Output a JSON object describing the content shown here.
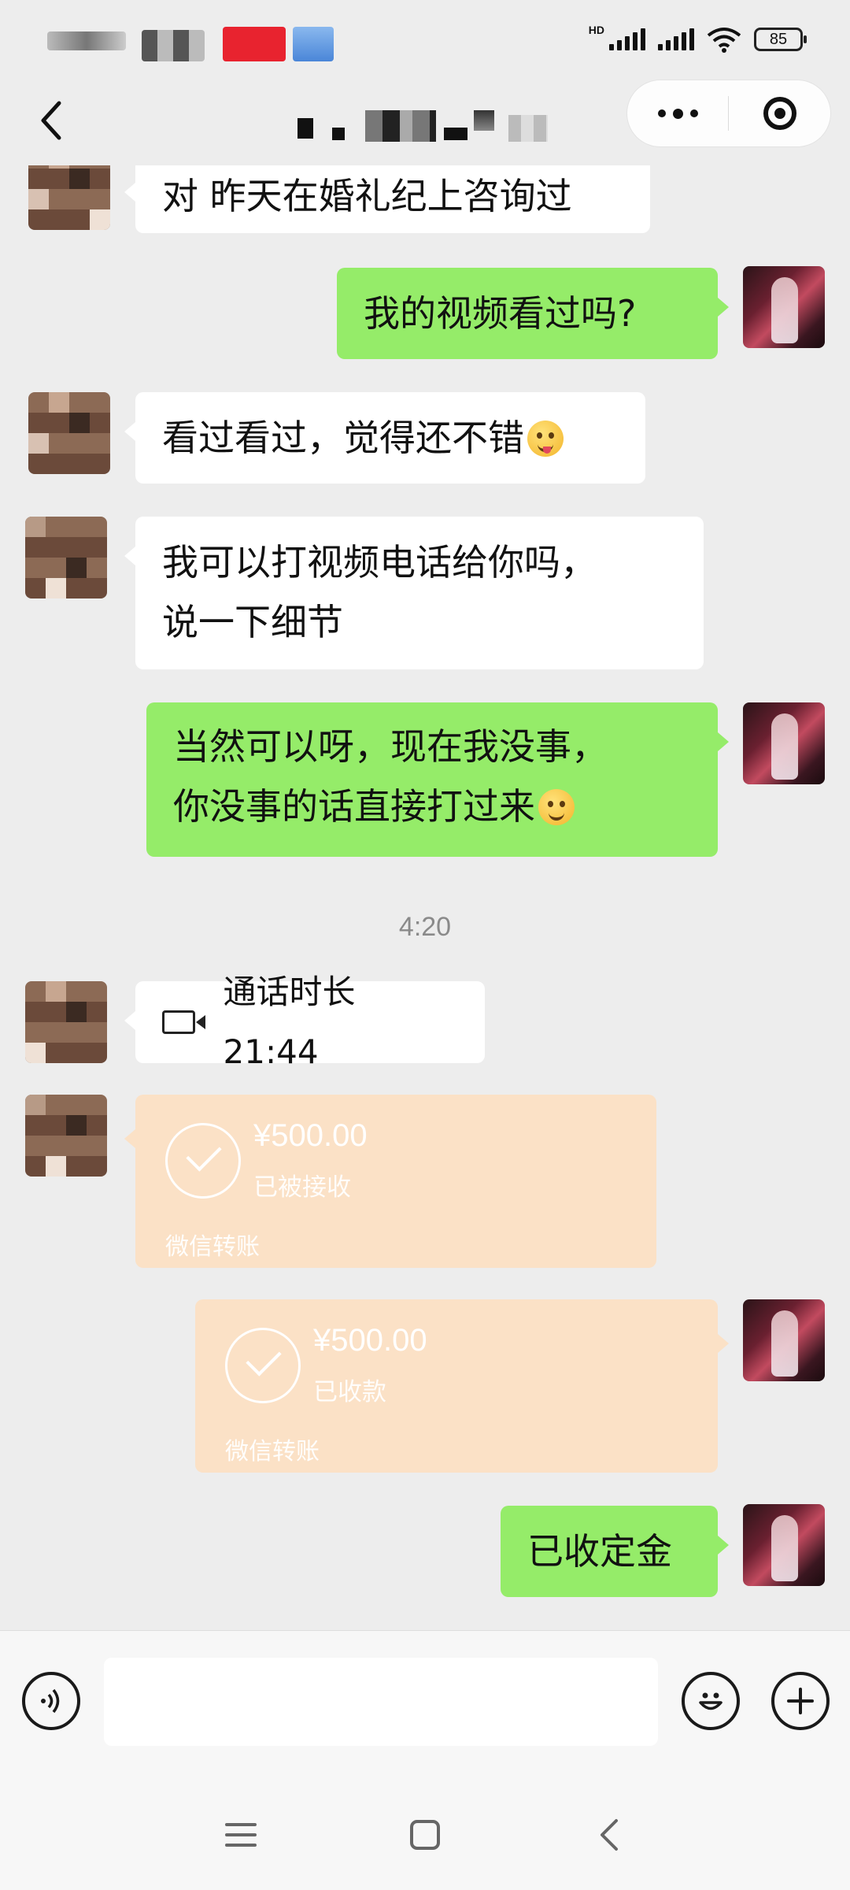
{
  "status_bar": {
    "network_tag": "HD",
    "battery": "85"
  },
  "header": {
    "capsule_more_icon": "more-dots-icon",
    "capsule_close_icon": "target-icon"
  },
  "messages": [
    {
      "side": "left",
      "text": "对 昨天在婚礼纪上咨询过"
    },
    {
      "side": "right",
      "text": "我的视频看过吗?"
    },
    {
      "side": "left",
      "text": "看过看过，觉得还不错"
    },
    {
      "side": "left",
      "line1": "我可以打视频电话给你吗，",
      "line2": "说一下细节"
    },
    {
      "side": "right",
      "line1": "当然可以呀，现在我没事，",
      "line2": "你没事的话直接打过来"
    }
  ],
  "timestamp": "4:20",
  "call": {
    "label": "通话时长 21:44",
    "icon": "video-call-icon"
  },
  "transfers": [
    {
      "side": "left",
      "amount": "¥500.00",
      "status": "已被接收",
      "brand": "微信转账"
    },
    {
      "side": "right",
      "amount": "¥500.00",
      "status": "已收款",
      "brand": "微信转账"
    }
  ],
  "last_message": {
    "side": "right",
    "text": "已收定金"
  },
  "input_bar": {
    "placeholder": "",
    "voice_icon": "voice-icon",
    "emoji_icon": "emoji-icon",
    "plus_icon": "plus-icon"
  },
  "nav": {
    "menu_icon": "menu-icon",
    "home_icon": "home-square-icon",
    "back_icon": "back-chevron-icon"
  },
  "colors": {
    "background": "#ededed",
    "bubble_green": "#95ec69",
    "bubble_white": "#ffffff",
    "transfer": "#fbe1c6"
  }
}
